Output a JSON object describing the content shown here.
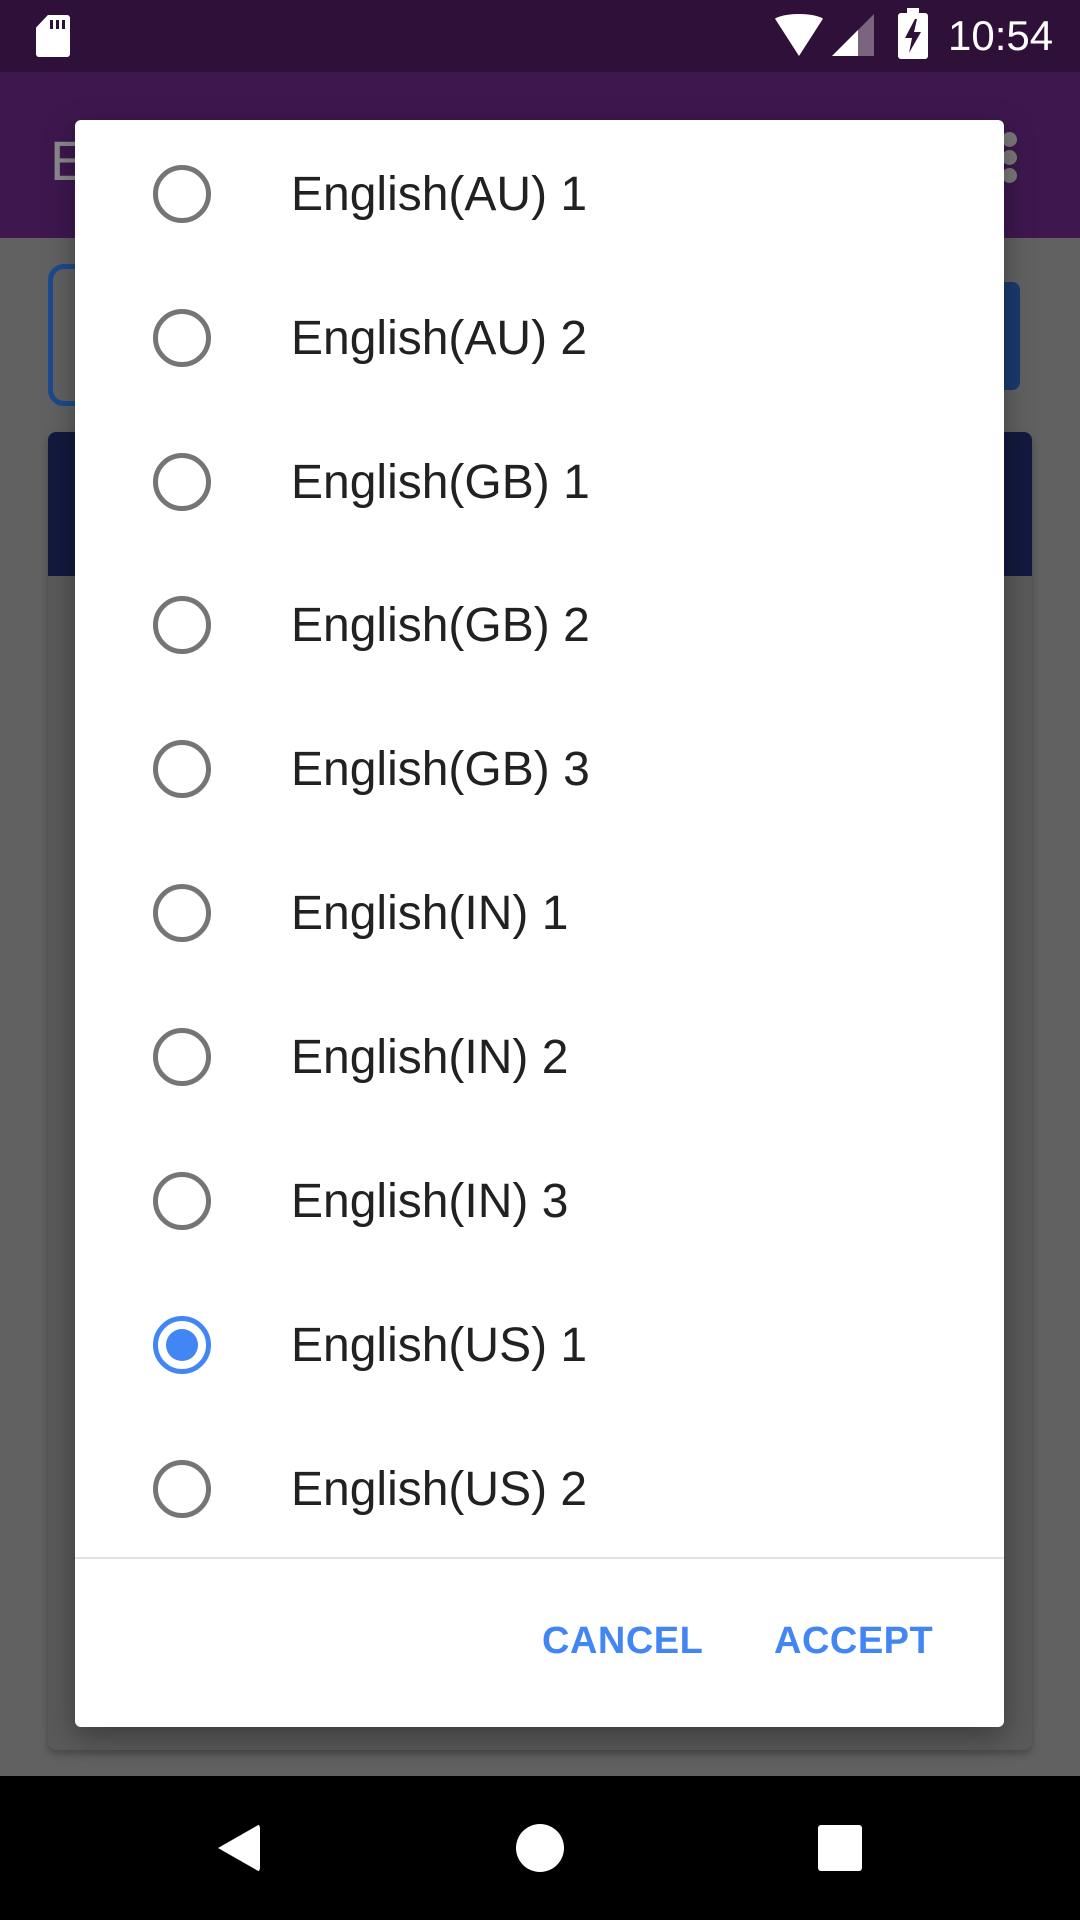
{
  "status_bar": {
    "time": "10:54",
    "icons": [
      "sd-card-icon",
      "wifi-icon",
      "signal-icon",
      "battery-charging-icon"
    ]
  },
  "app_bar": {
    "title_partial": "E",
    "overflow_icon": "more-vert-icon"
  },
  "dialog": {
    "options": [
      {
        "label": "English(AU) 1",
        "selected": false
      },
      {
        "label": "English(AU) 2",
        "selected": false
      },
      {
        "label": "English(GB) 1",
        "selected": false
      },
      {
        "label": "English(GB) 2",
        "selected": false
      },
      {
        "label": "English(GB) 3",
        "selected": false
      },
      {
        "label": "English(IN) 1",
        "selected": false
      },
      {
        "label": "English(IN) 2",
        "selected": false
      },
      {
        "label": "English(IN) 3",
        "selected": false
      },
      {
        "label": "English(US) 1",
        "selected": true
      },
      {
        "label": "English(US) 2",
        "selected": false
      }
    ],
    "cancel_label": "CANCEL",
    "accept_label": "ACCEPT",
    "accent_color": "#4285f4"
  },
  "nav_bar": {
    "buttons": [
      "back-icon",
      "home-icon",
      "recents-icon"
    ]
  }
}
